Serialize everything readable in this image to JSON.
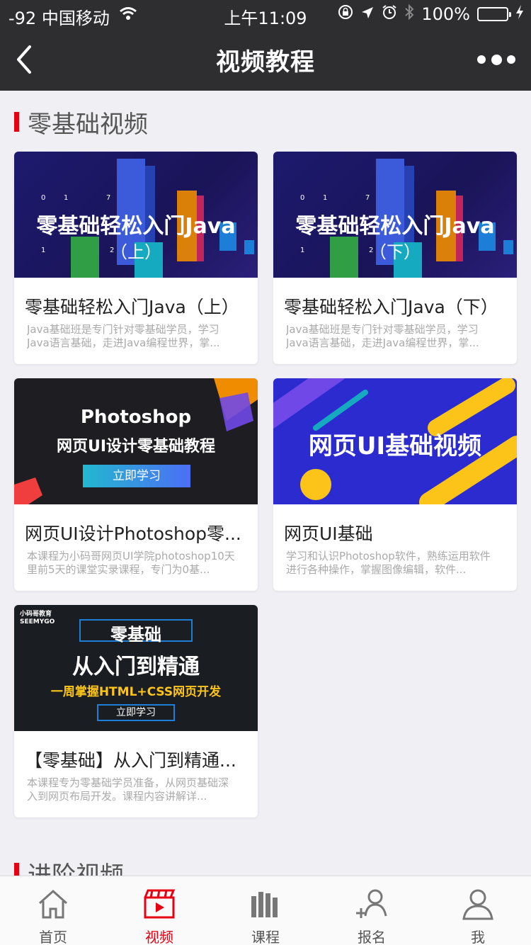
{
  "status_bar": {
    "signal": "-92 中国移动",
    "time": "上午11:09",
    "battery": "100%"
  },
  "nav": {
    "title": "视频教程"
  },
  "sections": [
    {
      "title": "零基础视频",
      "cards": [
        {
          "thumb_line1": "零基础轻松入门Java",
          "thumb_line2": "（上）",
          "title": "零基础轻松入门Java（上）",
          "desc": "Java基础班是专门针对零基础学员，学习Java语言基础，走进Java编程世界，掌..."
        },
        {
          "thumb_line1": "零基础轻松入门Java",
          "thumb_line2": "（下）",
          "title": "零基础轻松入门Java（下）",
          "desc": "Java基础班是专门针对零基础学员，学习Java语言基础，走进Java编程世界，掌..."
        },
        {
          "thumb_line1": "Photoshop",
          "thumb_line2": "网页UI设计零基础教程",
          "thumb_button": "立即学习",
          "title": "网页UI设计Photoshop零...",
          "desc": "本课程为小码哥网页UI学院photoshop10天里前5天的课堂实录课程，专门为0基..."
        },
        {
          "thumb_line1": "网页UI基础视频",
          "title": "网页UI基础",
          "desc": "学习和认识Photoshop软件，熟练运用软件进行各种操作，掌握图像编辑，软件..."
        },
        {
          "thumb_brand": "小码哥教育 SEEMYGO",
          "thumb_line1": "零基础",
          "thumb_line2": "从入门到精通",
          "thumb_line3": "一周掌握HTML+CSS网页开发",
          "thumb_button": "立即学习",
          "title": "【零基础】从入门到精通...",
          "desc": "本课程专为零基础学员准备，从网页基础深入到网页布局开发。课程内容讲解详..."
        }
      ]
    },
    {
      "title": "进阶视频"
    }
  ],
  "tabs": [
    {
      "label": "首页",
      "icon": "home-icon"
    },
    {
      "label": "视频",
      "icon": "video-icon"
    },
    {
      "label": "课程",
      "icon": "books-icon"
    },
    {
      "label": "报名",
      "icon": "add-user-icon"
    },
    {
      "label": "我",
      "icon": "user-icon"
    }
  ],
  "colors": {
    "accent": "#e60012",
    "header_bg": "#2e2e30",
    "page_bg": "#efeff4"
  }
}
